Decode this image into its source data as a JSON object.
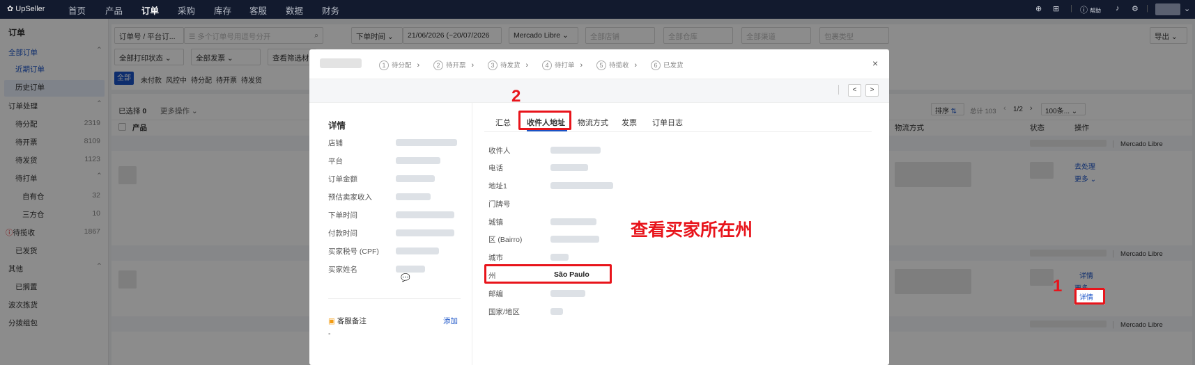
{
  "topbar": {
    "logo": "UpSeller",
    "nav": [
      "首页",
      "产品",
      "订单",
      "采购",
      "库存",
      "客服",
      "数据",
      "财务"
    ],
    "help": "帮助"
  },
  "sidebar": {
    "title": "订单",
    "group_all": "全部订单",
    "recent": "近期订单",
    "history": "历史订单",
    "group_process": "订单处理",
    "items": [
      {
        "label": "待分配",
        "count": "2319"
      },
      {
        "label": "待开票",
        "count": "8109"
      },
      {
        "label": "待发货",
        "count": "1123"
      }
    ],
    "to_print": "待打单",
    "own_wh": {
      "label": "自有仓",
      "count": "32"
    },
    "third_wh": {
      "label": "三方仓",
      "count": "10"
    },
    "to_collect": {
      "label": "待揽收",
      "count": "1867"
    },
    "shipped": "已发货",
    "group_other": "其他",
    "on_hold": "已搁置",
    "wave": "波次拣货",
    "sort": "分拨组包"
  },
  "filters": {
    "order_no": "订单号 / 平台订...",
    "search_placeholder": "多个订单号用逗号分开",
    "time_type": "下单时间",
    "date_range": "21/06/2026 (~20/07/2026",
    "platform": "Mercado Libre",
    "store": "全部店铺",
    "warehouse": "全部仓库",
    "channel": "全部渠道",
    "package": "包裹类型",
    "export": "导出",
    "print_status": "全部打印状态",
    "invoice": "全部发票",
    "view_filter": "查看筛选材"
  },
  "status_tabs": [
    "全部",
    "未付款",
    "风控中",
    "待分配",
    "待开票",
    "待发货"
  ],
  "list": {
    "selected_label": "已选择",
    "selected_count": "0",
    "more_ops": "更多操作",
    "sort": "排序",
    "total": "总计 103",
    "page": "1/2",
    "per_page": "100条...",
    "col_product": "产品",
    "col_shipping": "物流方式",
    "col_status": "状态",
    "col_action": "操作",
    "platform_tag": "Mercado Libre",
    "action_process": "去处理",
    "action_more": "更多",
    "action_detail": "详情"
  },
  "modal": {
    "steps": [
      "待分配",
      "待开票",
      "待发货",
      "待打单",
      "待揽收",
      "已发货"
    ],
    "detail_title": "详情",
    "detail_fields": [
      "店铺",
      "平台",
      "订单金额",
      "预估卖家收入",
      "下单时间",
      "付款时间",
      "买家税号 (CPF)",
      "买家姓名"
    ],
    "service_note": "客服备注",
    "add": "添加",
    "dash": "-",
    "tabs": [
      "汇总",
      "收件人地址",
      "物流方式",
      "发票",
      "订单日志"
    ],
    "addr_fields": [
      "收件人",
      "电话",
      "地址1",
      "门牌号",
      "城镇",
      "区 (Bairro)",
      "城市",
      "州",
      "邮编",
      "国家/地区"
    ],
    "state_value": "São Paulo"
  },
  "annotations": {
    "step1": "1",
    "step2": "2",
    "note": "查看买家所在州"
  },
  "colors": {
    "accent": "#1a53c7",
    "annotation": "#e8141b",
    "topbar": "#121a2e"
  }
}
